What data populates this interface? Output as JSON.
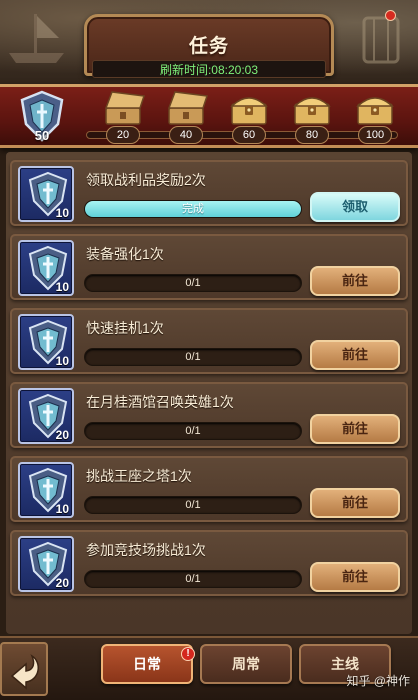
{
  "header": {
    "title": "任务",
    "refresh_label": "刷新时间:08:20:03"
  },
  "progress": {
    "current_score": "50",
    "milestones": [
      {
        "value": "20",
        "type": "open-chest"
      },
      {
        "value": "40",
        "type": "open-chest"
      },
      {
        "value": "60",
        "type": "closed-chest"
      },
      {
        "value": "80",
        "type": "closed-chest"
      },
      {
        "value": "100",
        "type": "closed-chest"
      }
    ],
    "track_fill_fraction": 0.0
  },
  "tasks": [
    {
      "title": "领取战利品奖励2次",
      "reward": "10",
      "progress_text": "完成",
      "progress_fraction": 1.0,
      "button": "领取",
      "state": "claim"
    },
    {
      "title": "装备强化1次",
      "reward": "10",
      "progress_text": "0/1",
      "progress_fraction": 0.0,
      "button": "前往",
      "state": "go"
    },
    {
      "title": "快速挂机1次",
      "reward": "10",
      "progress_text": "0/1",
      "progress_fraction": 0.0,
      "button": "前往",
      "state": "go"
    },
    {
      "title": "在月桂酒馆召唤英雄1次",
      "reward": "20",
      "progress_text": "0/1",
      "progress_fraction": 0.0,
      "button": "前往",
      "state": "go"
    },
    {
      "title": "挑战王座之塔1次",
      "reward": "10",
      "progress_text": "0/1",
      "progress_fraction": 0.0,
      "button": "前往",
      "state": "go"
    },
    {
      "title": "参加竞技场挑战1次",
      "reward": "20",
      "progress_text": "0/1",
      "progress_fraction": 0.0,
      "button": "前往",
      "state": "go"
    }
  ],
  "tabs": [
    {
      "label": "日常",
      "active": true,
      "badge": "!"
    },
    {
      "label": "周常",
      "active": false
    },
    {
      "label": "主线",
      "active": false
    }
  ],
  "watermark": "知乎 @神作",
  "colors": {
    "progress_fill": "#7fd6df",
    "go_button": "#c48a52",
    "claim_button": "#aee9ee",
    "active_tab": "#a8431f"
  }
}
